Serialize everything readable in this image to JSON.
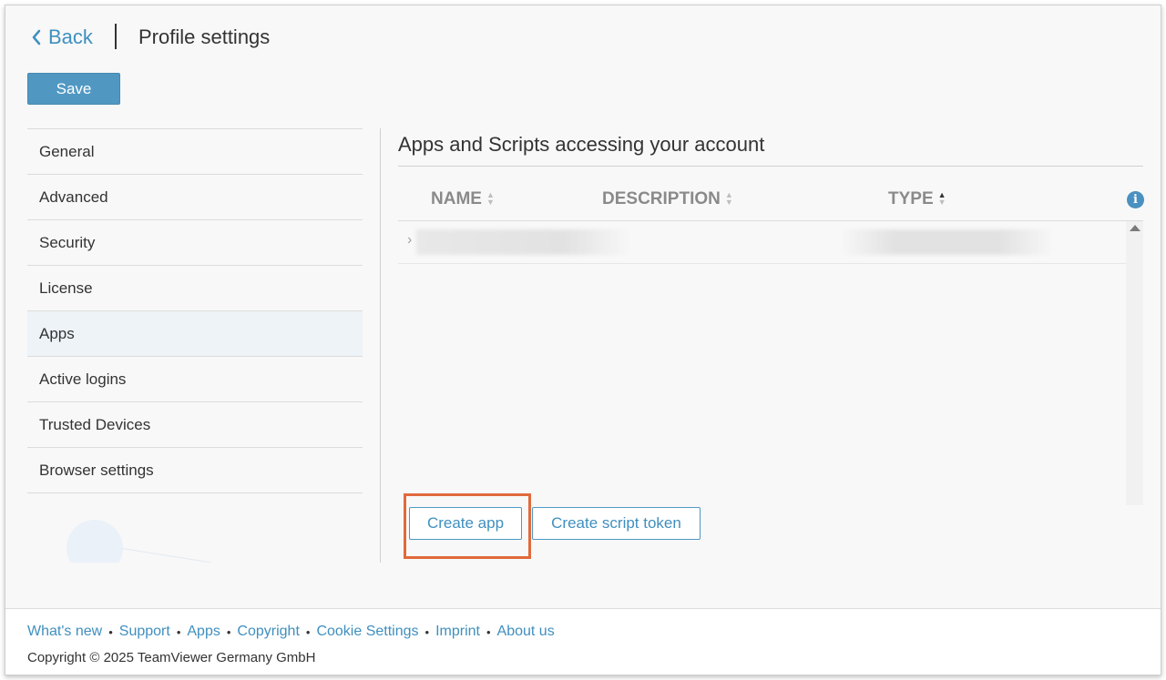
{
  "header": {
    "back_label": "Back",
    "title": "Profile settings",
    "save_label": "Save"
  },
  "sidebar": {
    "items": [
      {
        "label": "General"
      },
      {
        "label": "Advanced"
      },
      {
        "label": "Security"
      },
      {
        "label": "License"
      },
      {
        "label": "Apps",
        "active": true
      },
      {
        "label": "Active logins"
      },
      {
        "label": "Trusted Devices"
      },
      {
        "label": "Browser settings"
      }
    ]
  },
  "main": {
    "title": "Apps and Scripts accessing your account",
    "columns": [
      {
        "label": "NAME",
        "sort": "none"
      },
      {
        "label": "DESCRIPTION",
        "sort": "none"
      },
      {
        "label": "TYPE",
        "sort": "ascending"
      }
    ],
    "info_icon": "info-icon",
    "buttons": {
      "create_app": "Create app",
      "create_script_token": "Create script token"
    }
  },
  "footer": {
    "links": [
      "What's new",
      "Support",
      "Apps",
      "Copyright",
      "Cookie Settings",
      "Imprint",
      "About us"
    ],
    "copyright": "Copyright © 2025 TeamViewer Germany GmbH"
  },
  "colors": {
    "accent": "#5098c2",
    "link": "#3f8fbf",
    "highlight": "#e06a3c"
  }
}
